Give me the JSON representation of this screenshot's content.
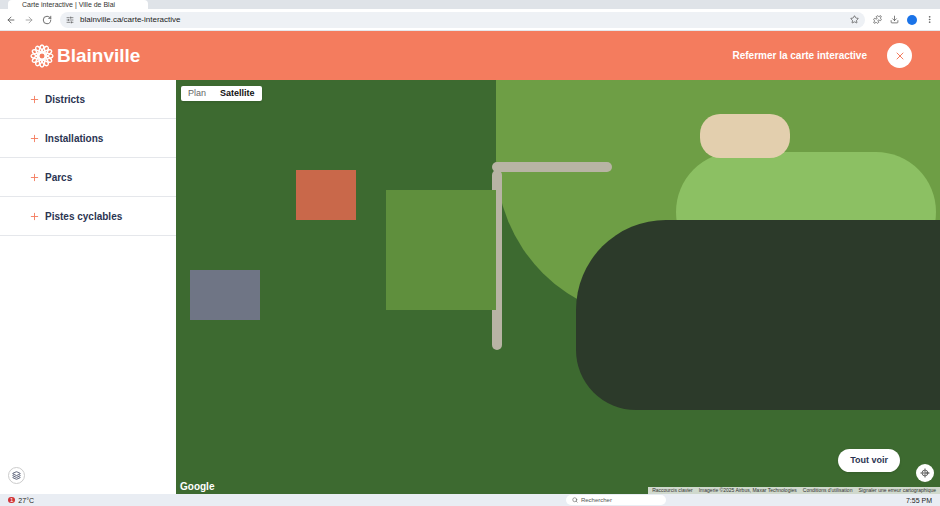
{
  "browser": {
    "tab_title": "Carte interactive | Ville de Blai",
    "url": "blainville.ca/carte-interactive"
  },
  "header": {
    "logo": "Blainville",
    "close_label": "Refermer la carte interactive"
  },
  "sidebar": {
    "items": [
      {
        "label": "Districts",
        "expanded": false
      },
      {
        "label": "Installations",
        "expanded": false
      },
      {
        "label": "Parcs",
        "expanded": false
      },
      {
        "label": "Pistes cyclables",
        "expanded": false
      }
    ]
  },
  "map": {
    "types": [
      {
        "label": "Plan",
        "selected": false
      },
      {
        "label": "Satellite",
        "selected": true
      }
    ],
    "show_all": "Tout voir",
    "provider": "Google",
    "attribution": [
      "Raccourcis clavier",
      "Imagerie ©2025 Airbus, Maxar Technologies",
      "Conditions d'utilisation",
      "Signaler une erreur cartographique"
    ]
  },
  "taskbar": {
    "weather": "27°C",
    "weather_badge": "1",
    "search_placeholder": "Rechercher",
    "time": "7:55 PM"
  }
}
